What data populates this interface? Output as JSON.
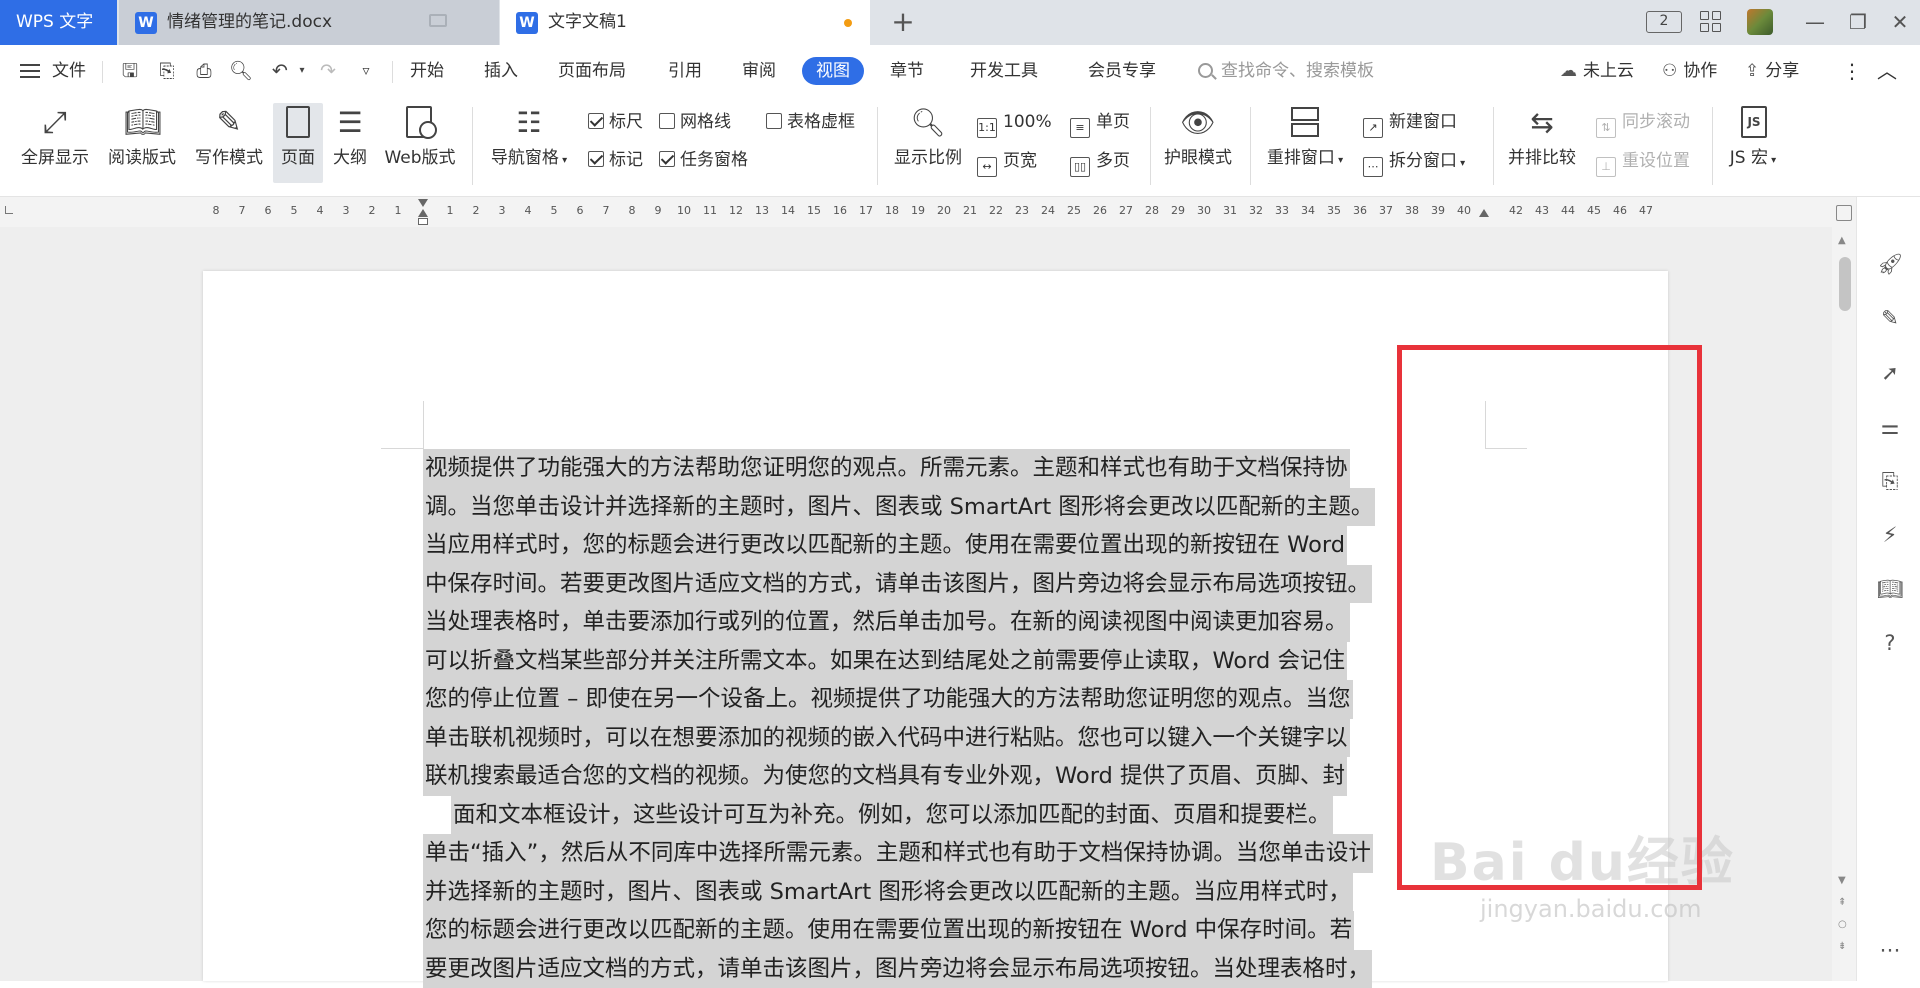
{
  "tabs": {
    "app": "WPS 文字",
    "doc1": "情绪管理的笔记.docx",
    "doc2": "文字文稿1",
    "add": "+"
  },
  "window": {
    "badge": "2",
    "minimize": "—",
    "restore": "❐",
    "close": "✕"
  },
  "menu": {
    "file": "文件",
    "tabs": [
      "开始",
      "插入",
      "页面布局",
      "引用",
      "审阅",
      "视图",
      "章节",
      "开发工具",
      "会员专享"
    ],
    "active_tab": "视图",
    "search_placeholder": "查找命令、搜索模板",
    "cloud": "未上云",
    "collab": "协作",
    "share": "分享"
  },
  "ribbon": {
    "fullscreen": "全屏显示",
    "reading": "阅读版式",
    "writing": "写作模式",
    "page": "页面",
    "outline": "大纲",
    "web": "Web版式",
    "nav_pane": "导航窗格",
    "ruler": "标尺",
    "gridlines": "网格线",
    "table_gridlines": "表格虚框",
    "marks": "标记",
    "task_pane": "任务窗格",
    "zoom": "显示比例",
    "zoom_100": "100%",
    "page_width": "页宽",
    "single_page": "单页",
    "multi_page": "多页",
    "eye_mode": "护眼模式",
    "rearrange": "重排窗口",
    "new_window": "新建窗口",
    "split_window": "拆分窗口",
    "side_by_side": "并排比较",
    "sync_scroll": "同步滚动",
    "reset_position": "重设位置",
    "js_macro": "JS 宏",
    "checks": {
      "ruler": true,
      "gridlines": false,
      "table_gridlines": false,
      "marks": true,
      "task_pane": true
    }
  },
  "ruler_numbers": [
    "8",
    "7",
    "6",
    "5",
    "4",
    "3",
    "2",
    "1",
    "",
    "1",
    "2",
    "3",
    "4",
    "5",
    "6",
    "7",
    "8",
    "9",
    "10",
    "11",
    "12",
    "13",
    "14",
    "15",
    "16",
    "17",
    "18",
    "19",
    "20",
    "21",
    "22",
    "23",
    "24",
    "25",
    "26",
    "27",
    "28",
    "29",
    "30",
    "31",
    "32",
    "33",
    "34",
    "35",
    "36",
    "37",
    "38",
    "39",
    "40",
    "",
    "42",
    "43",
    "44",
    "45",
    "46",
    "47"
  ],
  "document": {
    "lines": [
      "视频提供了功能强大的方法帮助您证明您的观点。所需元素。主题和样式也有助于文档保持协",
      "调。当您单击设计并选择新的主题时，图片、图表或 SmartArt 图形将会更改以匹配新的主题。",
      "当应用样式时，您的标题会进行更改以匹配新的主题。使用在需要位置出现的新按钮在 Word",
      "中保存时间。若要更改图片适应文档的方式，请单击该图片，图片旁边将会显示布局选项按钮。",
      "当处理表格时，单击要添加行或列的位置，然后单击加号。在新的阅读视图中阅读更加容易。",
      "可以折叠文档某些部分并关注所需文本。如果在达到结尾处之前需要停止读取，Word 会记住",
      "您的停止位置 – 即使在另一个设备上。视频提供了功能强大的方法帮助您证明您的观点。当您",
      "单击联机视频时，可以在想要添加的视频的嵌入代码中进行粘贴。您也可以键入一个关键字以",
      "联机搜索最适合您的文档的视频。为使您的文档具有专业外观，Word 提供了页眉、页脚、封",
      "面和文本框设计，这些设计可互为补充。例如，您可以添加匹配的封面、页眉和提要栏。",
      "单击“插入”，然后从不同库中选择所需元素。主题和样式也有助于文档保持协调。当您单击设计",
      "并选择新的主题时，图片、图表或 SmartArt 图形将会更改以匹配新的主题。当应用样式时，",
      "您的标题会进行更改以匹配新的主题。使用在需要位置出现的新按钮在 Word 中保存时间。若",
      "要更改图片适应文档的方式，请单击该图片，图片旁边将会显示布局选项按钮。当处理表格时，"
    ]
  },
  "watermark": {
    "brand": "Bai du经验",
    "url": "jingyan.baidu.com"
  },
  "colors": {
    "accent": "#2f6ee6",
    "annotation": "#e8323a",
    "selection": "#d4d4d4"
  }
}
